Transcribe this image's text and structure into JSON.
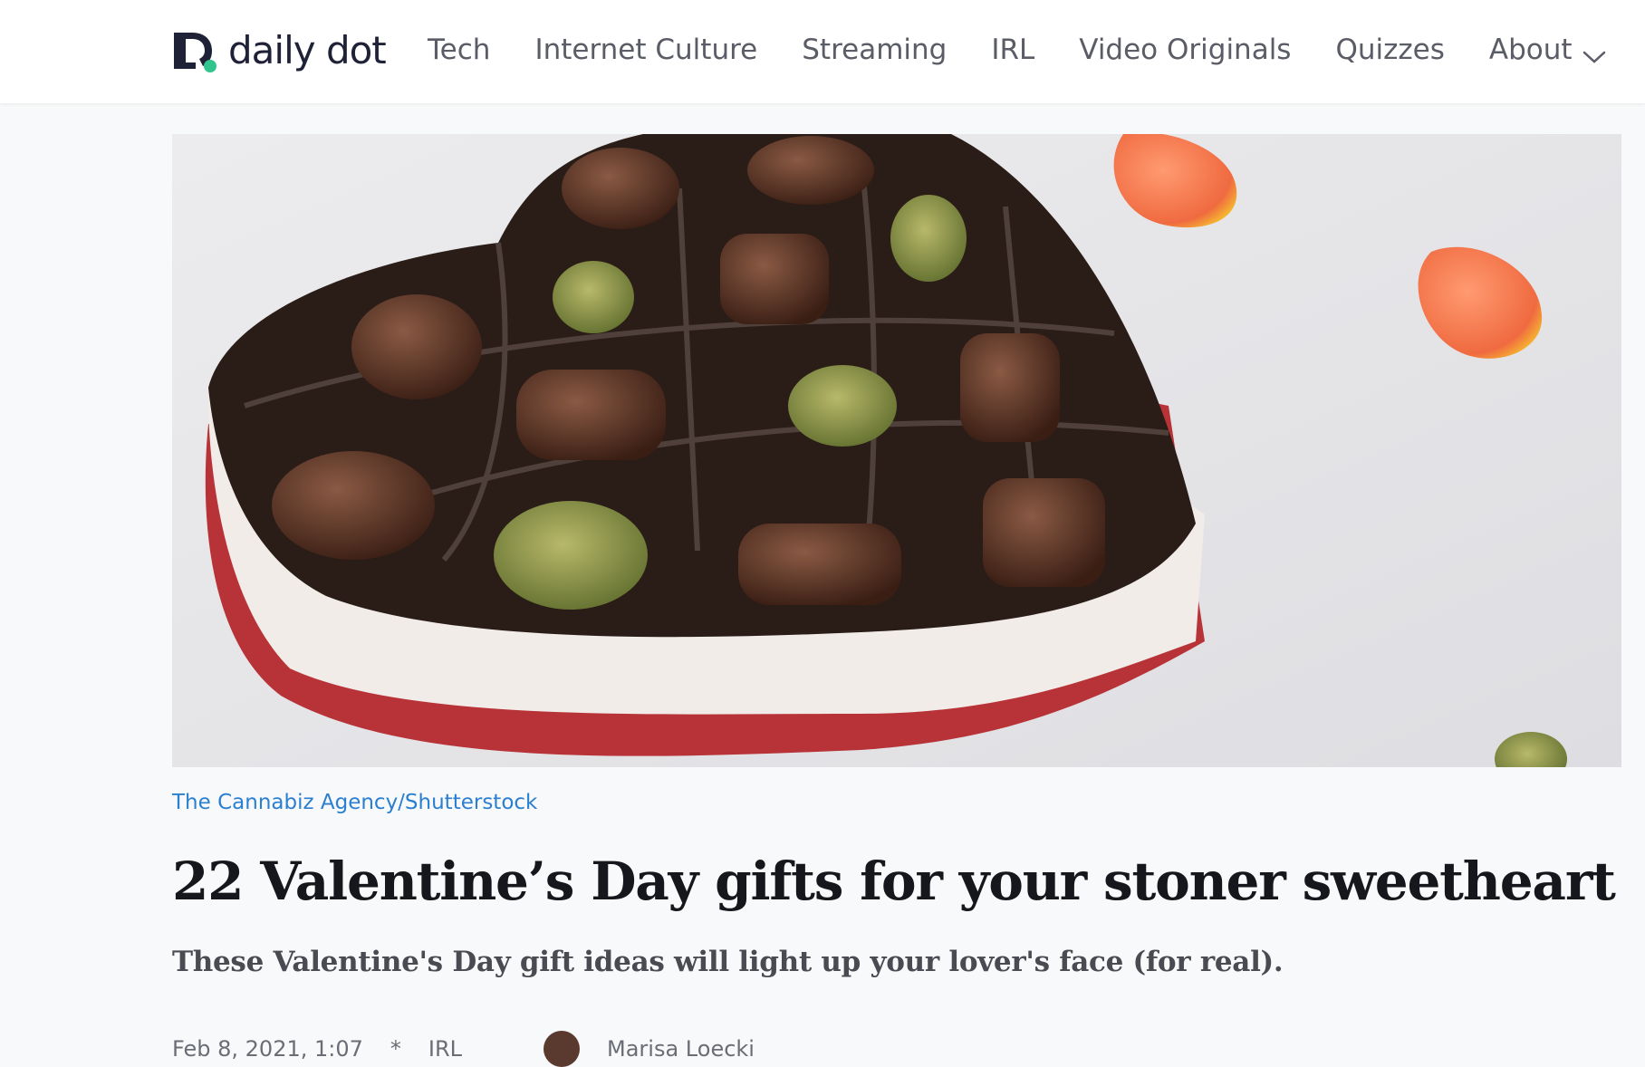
{
  "logo": {
    "text": "daily dot"
  },
  "nav": {
    "links": [
      "Tech",
      "Internet Culture",
      "Streaming",
      "IRL",
      "Video Originals",
      "Quizzes"
    ],
    "about": "About"
  },
  "hero": {
    "alt": "Heart-shaped box of chocolates with cannabis buds",
    "credit": "The Cannabiz Agency/Shutterstock"
  },
  "article": {
    "title": "22 Valentine’s Day gifts for your stoner sweetheart",
    "subtitle": "These Valentine's Day gift ideas will light up your lover's face (for real).",
    "date": "Feb 8, 2021, 1:07",
    "category": "IRL",
    "author": "Marisa Loecki"
  },
  "colors": {
    "logo_dot": "#32c48d",
    "logo_mark": "#1f2137",
    "credit_link": "#2b7fd0",
    "nav_text": "#5a5c66"
  }
}
